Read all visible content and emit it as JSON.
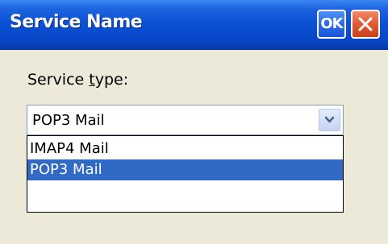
{
  "window": {
    "title": "Service Name",
    "ok_label": "OK"
  },
  "form": {
    "label_before": "Service ",
    "label_mnemonic": "t",
    "label_after": "ype:",
    "combo_value": "POP3 Mail",
    "options": [
      "IMAP4 Mail",
      "POP3 Mail"
    ]
  },
  "colors": {
    "titlebar": "#0a4fd4",
    "selection": "#316ac5",
    "close_button": "#e15a34",
    "background": "#ece9d8"
  }
}
